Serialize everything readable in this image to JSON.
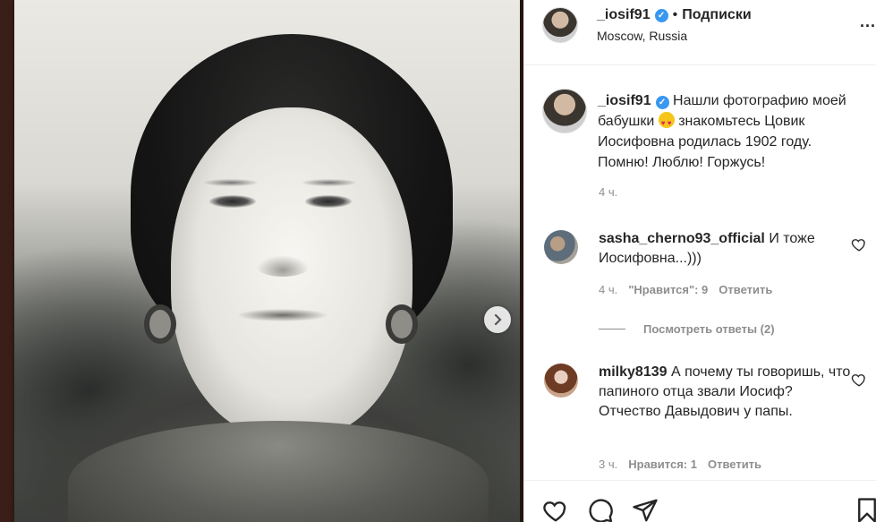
{
  "post": {
    "carousel_next_icon": "chevron-right-icon"
  },
  "header": {
    "username": "_iosif91",
    "verified_icon": "verified-badge-icon",
    "separator": "•",
    "follow_label": "Подписки",
    "location": "Moscow, Russia",
    "more_label": "..."
  },
  "caption": {
    "username": "_iosif91",
    "text_part1": "Нашли фотографию моей бабушки",
    "emoji": "heart-eyes-emoji",
    "text_part2": "знакомьтесь Цовик Иосифовна родилась 1902 году. Помню! Люблю! Горжусь!",
    "time": "4 ч."
  },
  "comments": [
    {
      "username": "sasha_cherno93_official",
      "text": "И тоже Иосифовна...)))",
      "time": "4 ч.",
      "likes": "\"Нравится\": 9",
      "reply_label": "Ответить"
    },
    {
      "username": "milky8139",
      "text": "А почему ты говоришь, что папиного отца звали Иосиф? Отчество Давыдович у папы.",
      "time": "3 ч.",
      "likes": "Нравится: 1",
      "reply_label": "Ответить"
    }
  ],
  "view_replies": "Посмотреть ответы (2)",
  "actions": {
    "like_icon": "heart-icon",
    "comment_icon": "comment-icon",
    "share_icon": "paper-plane-icon",
    "save_icon": "bookmark-icon"
  },
  "colors": {
    "verified": "#3897f0",
    "muted_text": "#8e8e8e",
    "text": "#262626"
  }
}
